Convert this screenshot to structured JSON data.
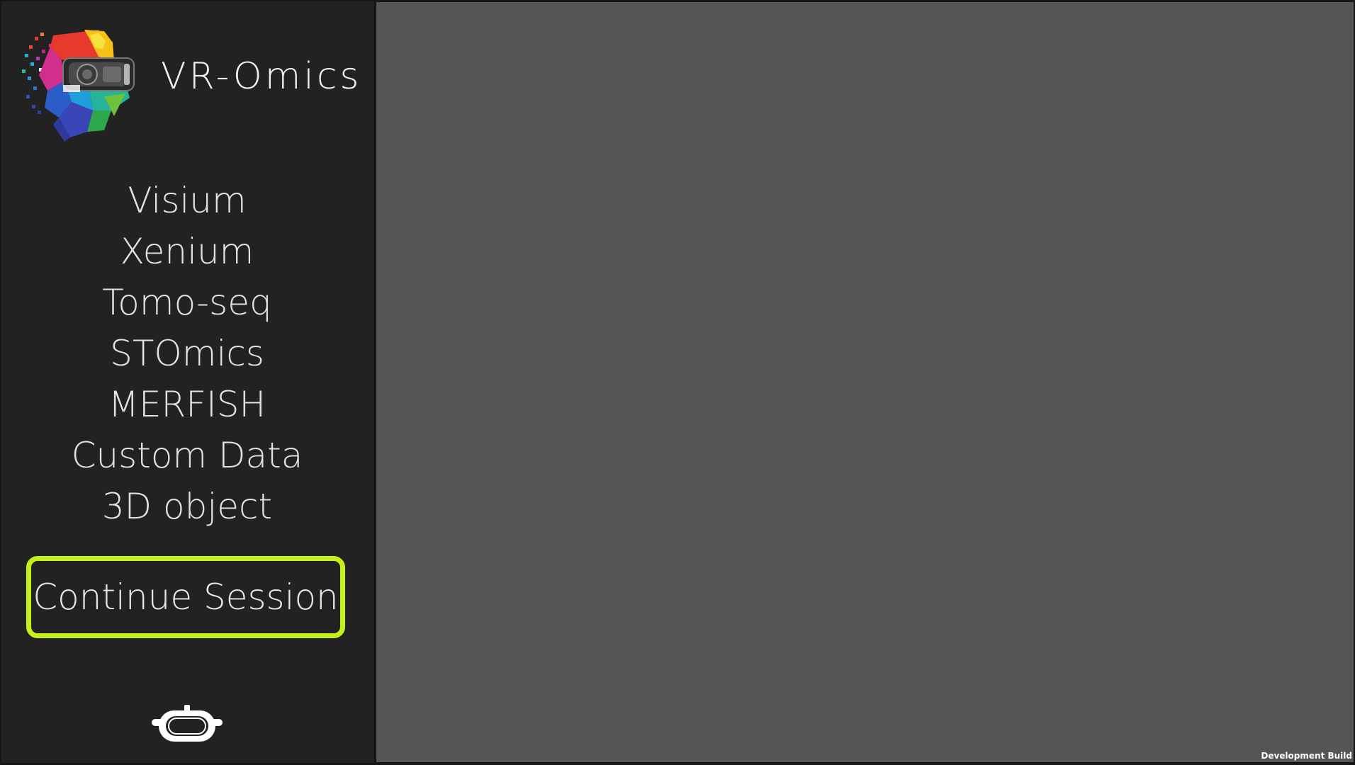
{
  "app": {
    "title": "VR-Omics",
    "accent_color": "#c6f01c"
  },
  "logo": {
    "icon": "vr-omics-logo-icon"
  },
  "menu": {
    "items": [
      {
        "label": "Visium"
      },
      {
        "label": "Xenium"
      },
      {
        "label": "Tomo-seq"
      },
      {
        "label": "STOmics"
      },
      {
        "label": "MERFISH"
      },
      {
        "label": "Custom Data"
      },
      {
        "label": "3D object"
      }
    ]
  },
  "continue_button": {
    "label": "Continue Session"
  },
  "vr_headset": {
    "icon": "vr-headset-icon"
  },
  "footer": {
    "build_label": "Development Build"
  }
}
